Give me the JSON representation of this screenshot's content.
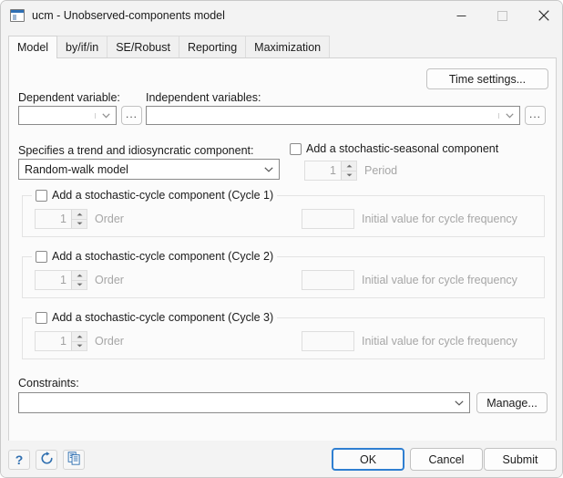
{
  "window": {
    "title": "ucm - Unobserved-components model",
    "icon": "dialog-form-icon",
    "controls": {
      "minimize": "minimize-icon",
      "maximize": "maximize-icon",
      "close": "close-icon"
    }
  },
  "tabs": [
    {
      "label": "Model",
      "active": true
    },
    {
      "label": "by/if/in",
      "active": false
    },
    {
      "label": "SE/Robust",
      "active": false
    },
    {
      "label": "Reporting",
      "active": false
    },
    {
      "label": "Maximization",
      "active": false
    }
  ],
  "main": {
    "time_settings_button": "Time settings...",
    "dependent_variable": {
      "label": "Dependent variable:",
      "value": "",
      "browse_button": "...",
      "arrow": "chevron-down-icon"
    },
    "independent_variables": {
      "label": "Independent variables:",
      "value": "",
      "browse_button": "...",
      "arrow": "chevron-down-icon"
    },
    "trend": {
      "label": "Specifies a trend and idiosyncratic component:",
      "value": "Random-walk model",
      "arrow": "chevron-down-icon"
    },
    "seasonal": {
      "checkbox_label": "Add a stochastic-seasonal component",
      "checked": false,
      "period_value": "1",
      "period_label": "Period"
    },
    "cycles": [
      {
        "checkbox_label": "Add a stochastic-cycle component (Cycle 1)",
        "checked": false,
        "order_value": "1",
        "order_label": "Order",
        "initial_value": "",
        "initial_label": "Initial value for cycle frequency"
      },
      {
        "checkbox_label": "Add a stochastic-cycle component (Cycle 2)",
        "checked": false,
        "order_value": "1",
        "order_label": "Order",
        "initial_value": "",
        "initial_label": "Initial value for cycle frequency"
      },
      {
        "checkbox_label": "Add a stochastic-cycle component (Cycle 3)",
        "checked": false,
        "order_value": "1",
        "order_label": "Order",
        "initial_value": "",
        "initial_label": "Initial value for cycle frequency"
      }
    ],
    "constraints": {
      "label": "Constraints:",
      "value": "",
      "arrow": "chevron-down-icon",
      "manage_button": "Manage..."
    }
  },
  "footer": {
    "help_icon": "?",
    "reset_icon": "refresh-icon",
    "copy_icon": "copy-icon",
    "ok_button": "OK",
    "cancel_button": "Cancel",
    "submit_button": "Submit"
  },
  "colors": {
    "accent": "#2f7fd1",
    "icon_blue": "#2f6fb0",
    "panel_bg": "#fbfbfb",
    "chrome_bg": "#f3f3f3"
  }
}
